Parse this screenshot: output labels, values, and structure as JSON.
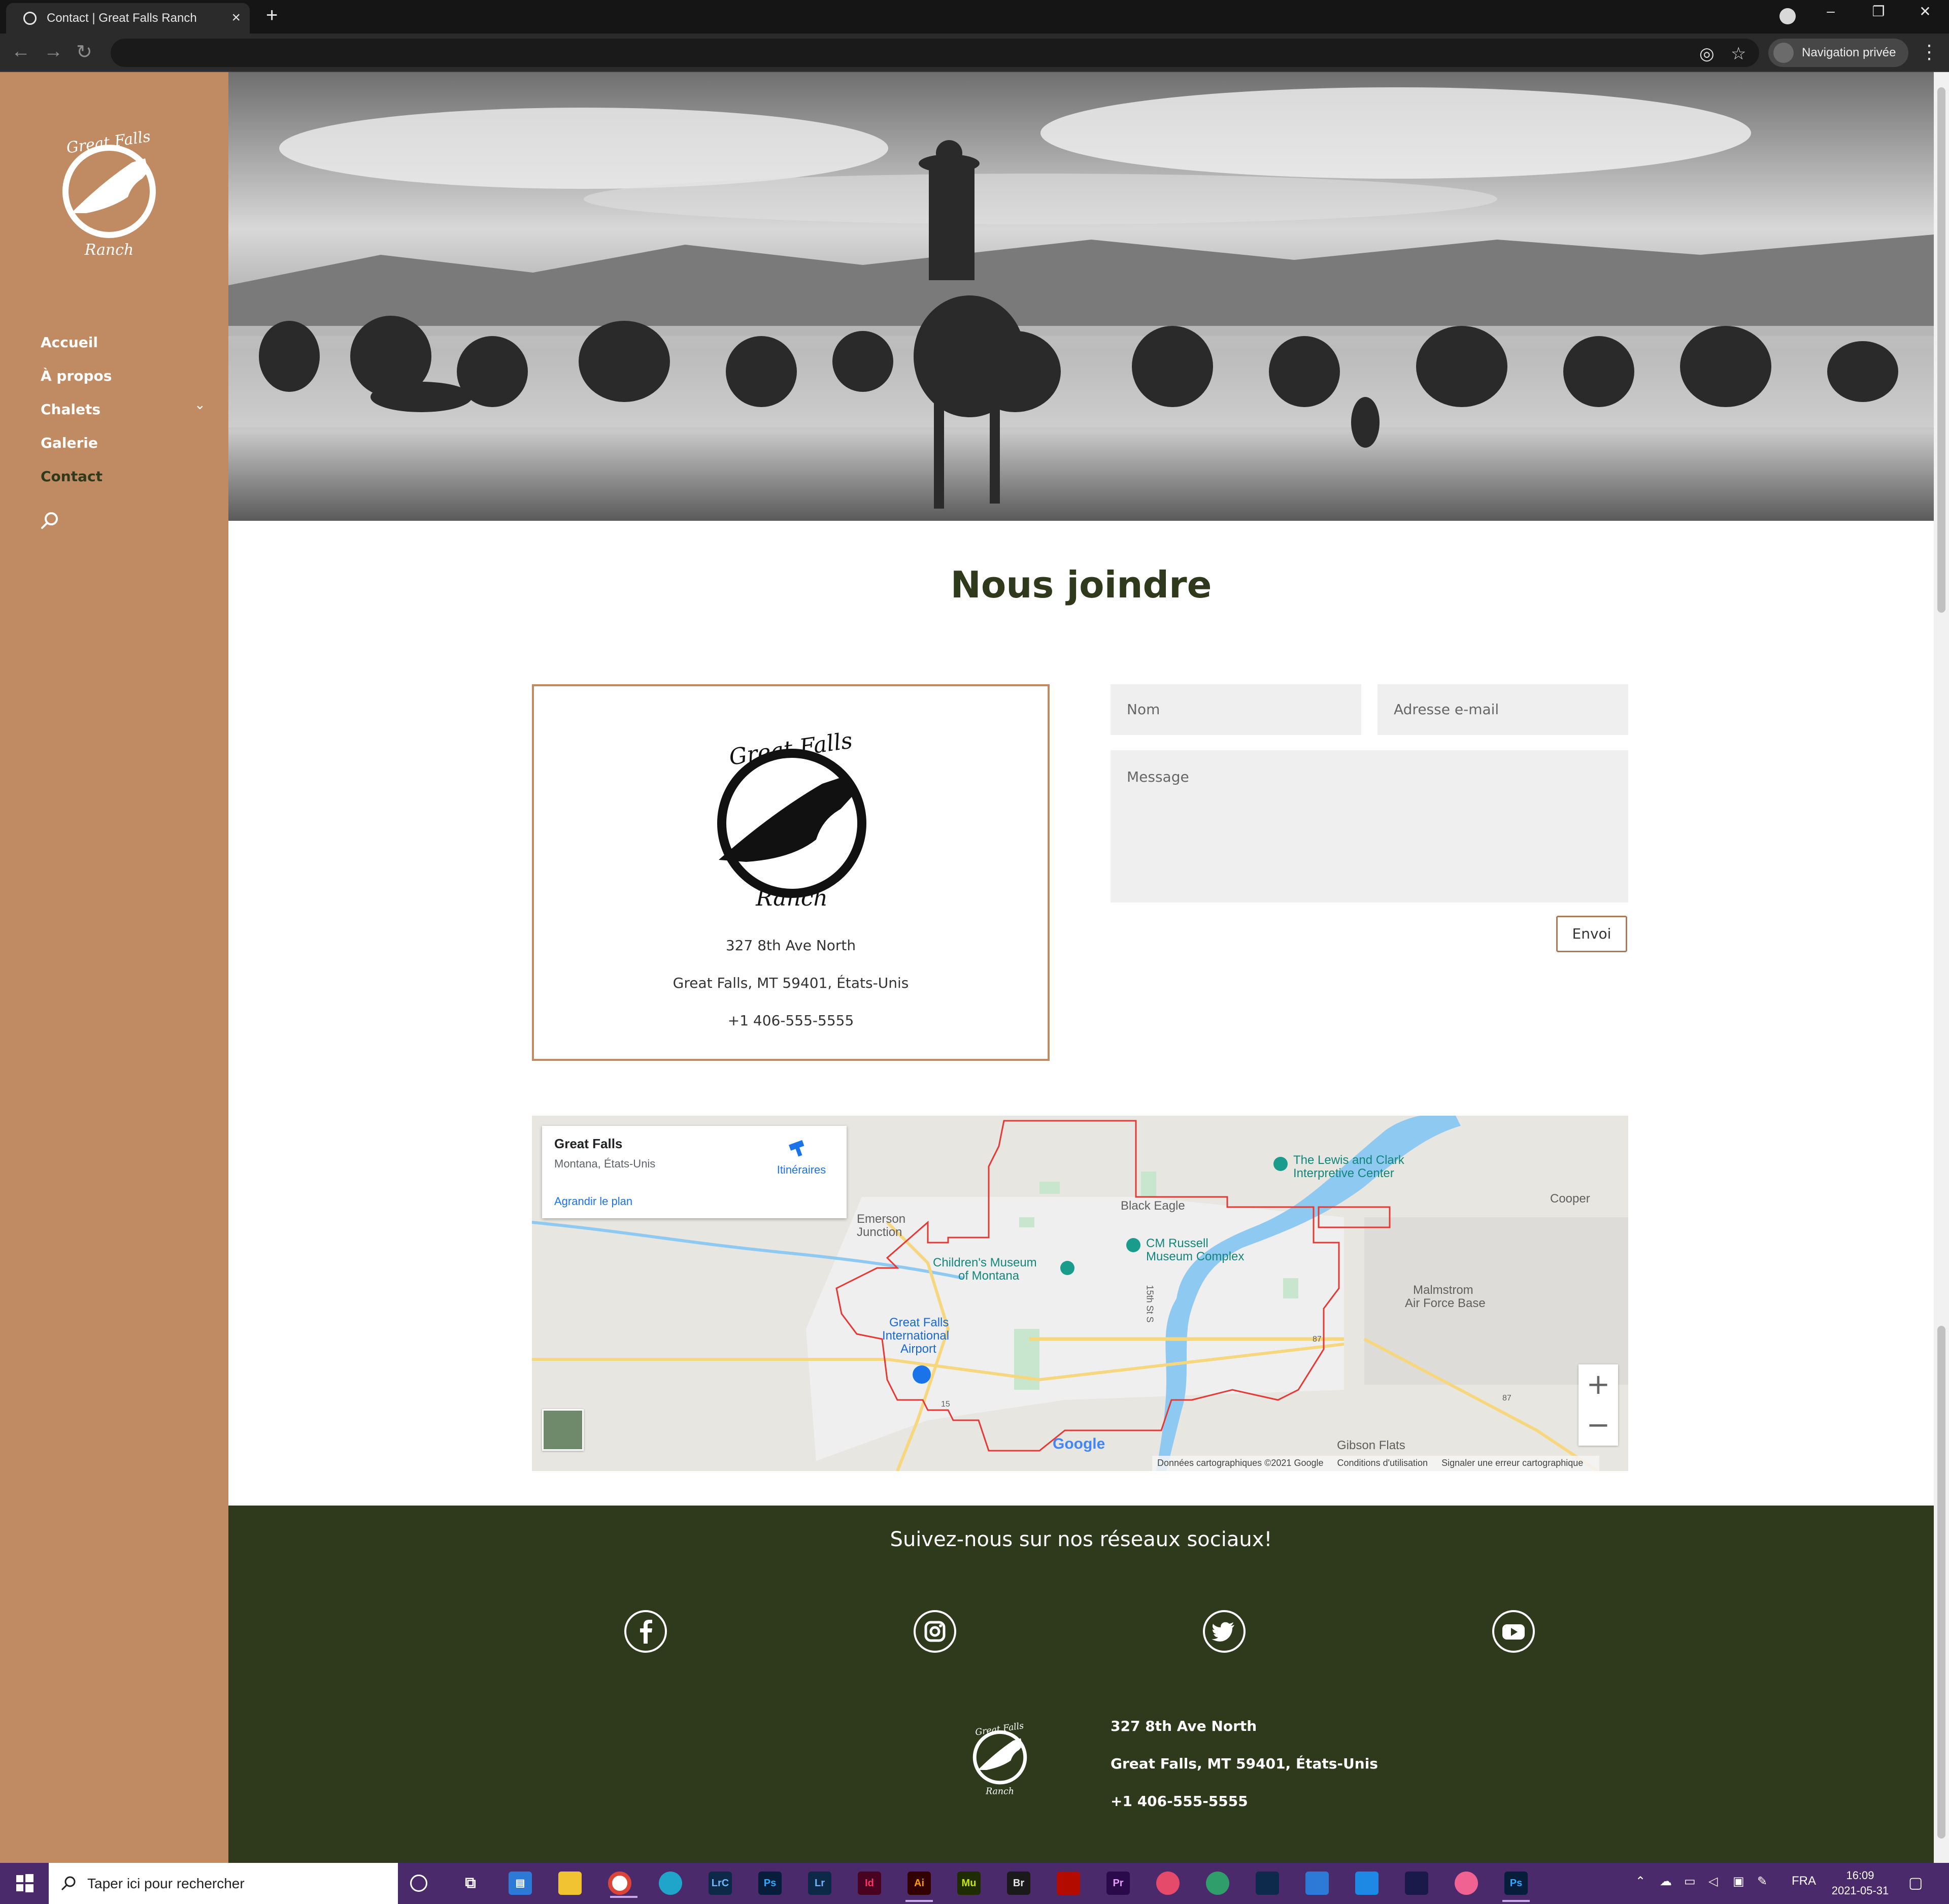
{
  "browser": {
    "tab_title": "Contact | Great Falls Ranch",
    "new_tab": "+",
    "close_tab": "×",
    "minimize": "–",
    "restore": "❐",
    "close_window": "✕",
    "private_label": "Navigation privée"
  },
  "sidebar": {
    "logo_alt": "Great Falls Ranch",
    "items": [
      {
        "label": "Accueil"
      },
      {
        "label": "À propos"
      },
      {
        "label": "Chalets"
      },
      {
        "label": "Galerie"
      },
      {
        "label": "Contact"
      }
    ],
    "active": "Contact"
  },
  "page": {
    "heading": "Nous joindre"
  },
  "contact_card": {
    "address_line1": "327 8th Ave North",
    "address_line2": "Great Falls, MT 59401, États-Unis",
    "phone": "+1 406-555-5555"
  },
  "form": {
    "name_placeholder": "Nom",
    "email_placeholder": "Adresse e-mail",
    "message_placeholder": "Message",
    "submit_label": "Envoi"
  },
  "map": {
    "place_title": "Great Falls",
    "place_subtitle": "Montana, États-Unis",
    "directions_label": "Itinéraires",
    "enlarge_label": "Agrandir le plan",
    "zoom_in": "+",
    "zoom_out": "−",
    "google": "Google",
    "attribution": [
      "Données cartographiques ©2021 Google",
      "Conditions d'utilisation",
      "Signaler une erreur cartographique"
    ],
    "labels": {
      "lewis_clark": "The Lewis and Clark",
      "lewis_clark2": "Interpretive Center",
      "black_eagle": "Black Eagle",
      "cooper": "Cooper",
      "emerson": "Emerson",
      "emerson2": "Junction",
      "cm_russell": "CM Russell",
      "cm_russell2": "Museum Complex",
      "childrens": "Children's Museum",
      "childrens2": "of Montana",
      "malmstrom": "Malmstrom",
      "malmstrom2": "Air Force Base",
      "airport": "Great Falls",
      "airport2": "International",
      "airport3": "Airport",
      "fifteenth": "15th St S",
      "gibson": "Gibson Flats",
      "i15": "15",
      "us87a": "87",
      "us87b": "87"
    }
  },
  "footer": {
    "title": "Suivez-nous sur nos réseaux sociaux!",
    "social": [
      "facebook",
      "instagram",
      "twitter",
      "youtube"
    ],
    "address_line1": "327 8th Ave North",
    "address_line2": "Great Falls, MT 59401, États-Unis",
    "phone": "+1 406-555-5555"
  },
  "taskbar": {
    "search_placeholder": "Taper ici pour rechercher",
    "apps": [
      "LrC",
      "Ps",
      "Lr",
      "Id",
      "Ai",
      "Mu",
      "Br",
      "Pr",
      "Ps"
    ],
    "language": "FRA",
    "time": "16:09",
    "date": "2021-05-31"
  },
  "colors": {
    "sidebar": "#c08b63",
    "accent_green": "#2e3a1b",
    "card_border": "#c08b63",
    "taskbar": "#4b2a6b"
  }
}
